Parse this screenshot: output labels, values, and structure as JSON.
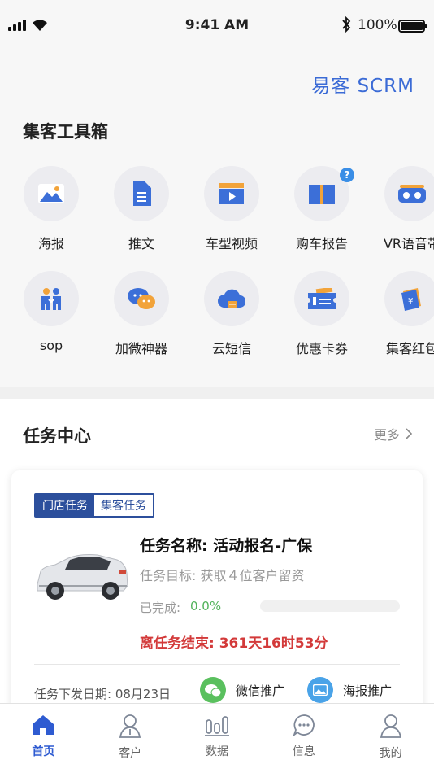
{
  "status_bar": {
    "time": "9:41 AM",
    "battery": "100%"
  },
  "brand": "易客 SCRM",
  "toolbox": {
    "title": "集客工具箱",
    "items": [
      {
        "label": "海报",
        "icon": "image-icon"
      },
      {
        "label": "推文",
        "icon": "document-icon"
      },
      {
        "label": "车型视频",
        "icon": "video-icon"
      },
      {
        "label": "购车报告",
        "icon": "book-icon",
        "badge": "?"
      },
      {
        "label": "VR语音带",
        "icon": "vr-glasses-icon"
      },
      {
        "label": "sop",
        "icon": "people-icon"
      },
      {
        "label": "加微神器",
        "icon": "wechat-icon"
      },
      {
        "label": "云短信",
        "icon": "cloud-message-icon"
      },
      {
        "label": "优惠卡券",
        "icon": "ticket-icon"
      },
      {
        "label": "集客红包",
        "icon": "red-packet-icon"
      }
    ]
  },
  "tasks": {
    "title": "任务中心",
    "more": "更多",
    "tabs": [
      "门店任务",
      "集客任务"
    ],
    "card": {
      "name": "任务名称: 活动报名-广保",
      "goal": "任务目标: 获取４位客户留资",
      "completed_label": "已完成:",
      "completed_value": "0.0%",
      "progress": 0.0,
      "deadline": "离任务结束: 361天16时53分",
      "issue_date": "任务下发日期: 08月23日",
      "share_wechat": "微信推广",
      "share_poster": "海报推广"
    }
  },
  "tabbar": [
    {
      "label": "首页",
      "icon": "home-icon",
      "active": true
    },
    {
      "label": "客户",
      "icon": "customer-icon",
      "active": false
    },
    {
      "label": "数据",
      "icon": "data-icon",
      "active": false
    },
    {
      "label": "信息",
      "icon": "message-icon",
      "active": false
    },
    {
      "label": "我的",
      "icon": "profile-icon",
      "active": false
    }
  ],
  "colors": {
    "brand": "#3b6bd6",
    "accent": "#2e5bd1",
    "success": "#52b35b",
    "danger": "#d33a3a"
  }
}
